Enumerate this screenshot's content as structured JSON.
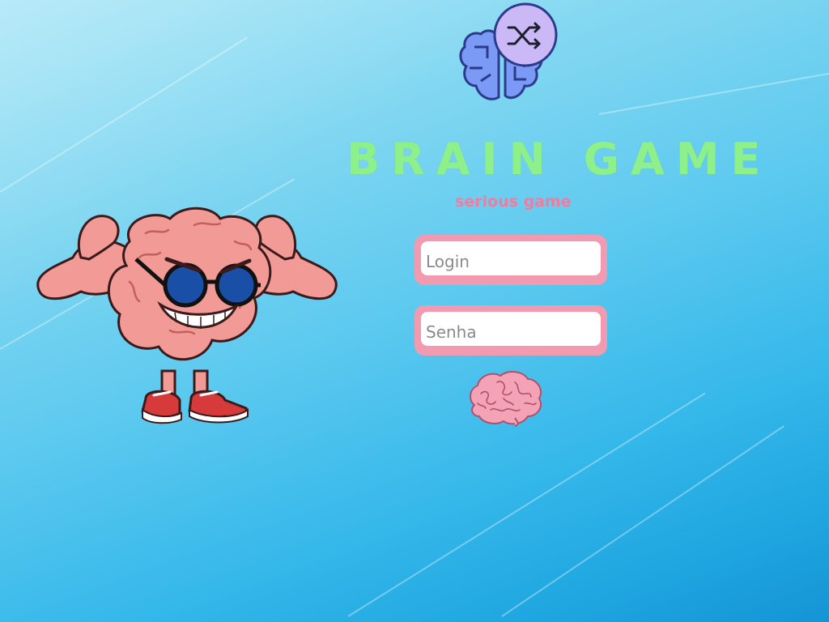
{
  "app": {
    "title": "BRAIN GAME",
    "subtitle": "serious game"
  },
  "form": {
    "login_placeholder": "Login",
    "password_placeholder": "Senha"
  },
  "colors": {
    "title": "#8ef08a",
    "subtitle": "#f07ca0",
    "field_border": "#f19ab0",
    "brain_pink": "#f4a3b7",
    "logo_blue": "#7a9af5",
    "logo_circle": "#cbb8f7"
  },
  "icons": {
    "logo": "brain-shuffle-icon",
    "submit": "brain-icon",
    "mascot": "muscular-brain-mascot"
  }
}
